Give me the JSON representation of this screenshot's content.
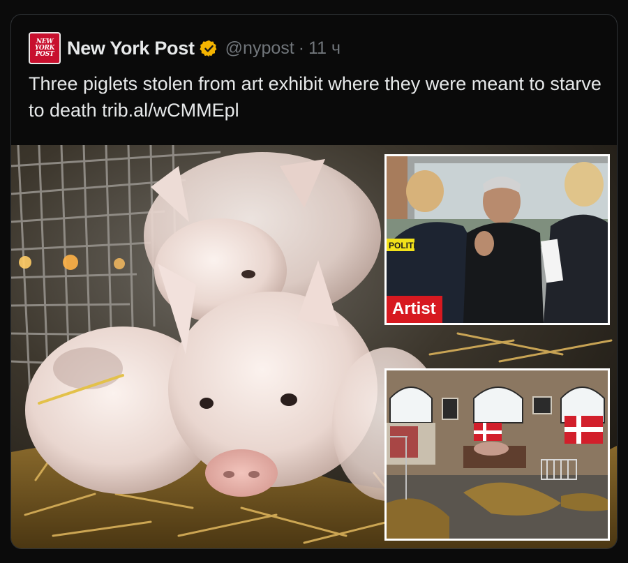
{
  "post": {
    "avatar_text": [
      "NEW",
      "YORK",
      "POST"
    ],
    "display_name": "New York Post",
    "verified": true,
    "verified_color": "#f4b400",
    "handle": "@nypost",
    "separator": "·",
    "time": "11 ч",
    "text": "Three piglets stolen from art exhibit where they were meant to starve to death ",
    "link": "trib.al/wCMMEpl"
  },
  "media": {
    "main_image": "piglets-in-cage-on-straw",
    "inset_artist": {
      "image": "artist-talking-to-police",
      "vest_text": "POLITI",
      "label": "Artist",
      "label_color": "#d71920"
    },
    "inset_exhibit": {
      "image": "empty-exhibit-hall-with-straw-and-danish-flags"
    }
  },
  "colors": {
    "background": "#0a0a0a",
    "text": "#e7e9ea",
    "muted": "#71767b",
    "border": "#2f3336",
    "brand_red": "#c8102e"
  }
}
